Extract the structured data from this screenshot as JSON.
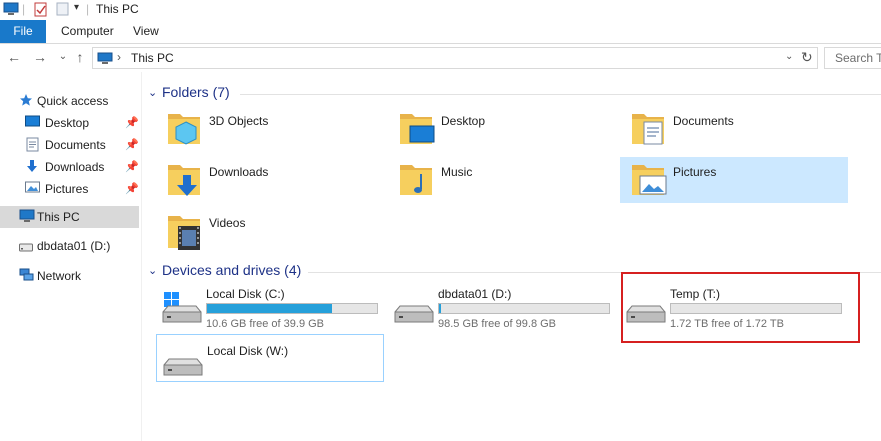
{
  "window": {
    "title": "This PC"
  },
  "ribbon": {
    "file_tab": "File",
    "tabs": [
      "Computer",
      "View"
    ]
  },
  "address": {
    "location": "This PC",
    "search_placeholder": "Search This PC"
  },
  "sidebar": {
    "items": [
      {
        "label": "Quick access",
        "icon": "star-icon"
      },
      {
        "label": "Desktop",
        "icon": "desktop-icon",
        "pinned": true
      },
      {
        "label": "Documents",
        "icon": "documents-icon",
        "pinned": true
      },
      {
        "label": "Downloads",
        "icon": "downloads-icon",
        "pinned": true
      },
      {
        "label": "Pictures",
        "icon": "pictures-icon",
        "pinned": true
      },
      {
        "label": "This PC",
        "icon": "computer-icon",
        "selected": true
      },
      {
        "label": "dbdata01 (D:)",
        "icon": "drive-icon"
      },
      {
        "label": "Network",
        "icon": "network-icon"
      }
    ]
  },
  "folders": {
    "header": "Folders (7)",
    "items": [
      {
        "label": "3D Objects",
        "icon": "3d-objects-folder-icon"
      },
      {
        "label": "Desktop",
        "icon": "desktop-folder-icon"
      },
      {
        "label": "Documents",
        "icon": "documents-folder-icon"
      },
      {
        "label": "Downloads",
        "icon": "downloads-folder-icon"
      },
      {
        "label": "Music",
        "icon": "music-folder-icon"
      },
      {
        "label": "Pictures",
        "icon": "pictures-folder-icon",
        "selected": true
      },
      {
        "label": "Videos",
        "icon": "videos-folder-icon"
      }
    ]
  },
  "drives": {
    "header": "Devices and drives (4)",
    "items": [
      {
        "name": "Local Disk (C:)",
        "free_text": "10.6 GB free of 39.9 GB",
        "used_fraction": 0.734
      },
      {
        "name": "dbdata01 (D:)",
        "free_text": "98.5 GB free of 99.8 GB",
        "used_fraction": 0.013
      },
      {
        "name": "Temp (T:)",
        "free_text": "1.72 TB free of 1.72 TB",
        "used_fraction": 0.0
      },
      {
        "name": "Local Disk (W:)",
        "free_text": "",
        "used_fraction": null
      }
    ]
  },
  "colors": {
    "accent": "#1979ca",
    "header_text": "#1e3287",
    "selection": "#cce8ff",
    "callout": "#d62020",
    "usage_bar": "#26a0da"
  }
}
